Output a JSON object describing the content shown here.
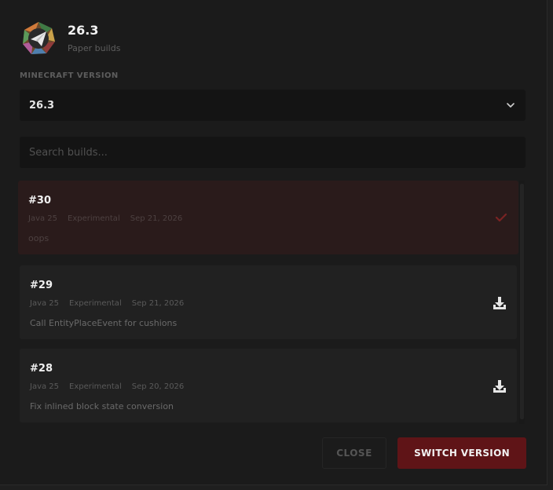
{
  "header": {
    "title": "26.3",
    "subtitle": "Paper builds"
  },
  "version_select": {
    "label": "MINECRAFT VERSION",
    "value": "26.3"
  },
  "search": {
    "placeholder": "Search builds..."
  },
  "builds": [
    {
      "number": "#30",
      "java": "Java 25",
      "channel": "Experimental",
      "date": "Sep 21, 2026",
      "description": "oops",
      "selected": true,
      "icon": "check-icon"
    },
    {
      "number": "#29",
      "java": "Java 25",
      "channel": "Experimental",
      "date": "Sep 21, 2026",
      "description": "Call EntityPlaceEvent for cushions",
      "selected": false,
      "icon": "download-icon"
    },
    {
      "number": "#28",
      "java": "Java 25",
      "channel": "Experimental",
      "date": "Sep 20, 2026",
      "description": "Fix inlined block state conversion",
      "selected": false,
      "icon": "download-icon"
    }
  ],
  "actions": {
    "close_label": "CLOSE",
    "switch_label": "SWITCH VERSION"
  },
  "colors": {
    "accent": "#5f1417",
    "selected_row": "#2a1b1b",
    "check": "#7a2323"
  }
}
